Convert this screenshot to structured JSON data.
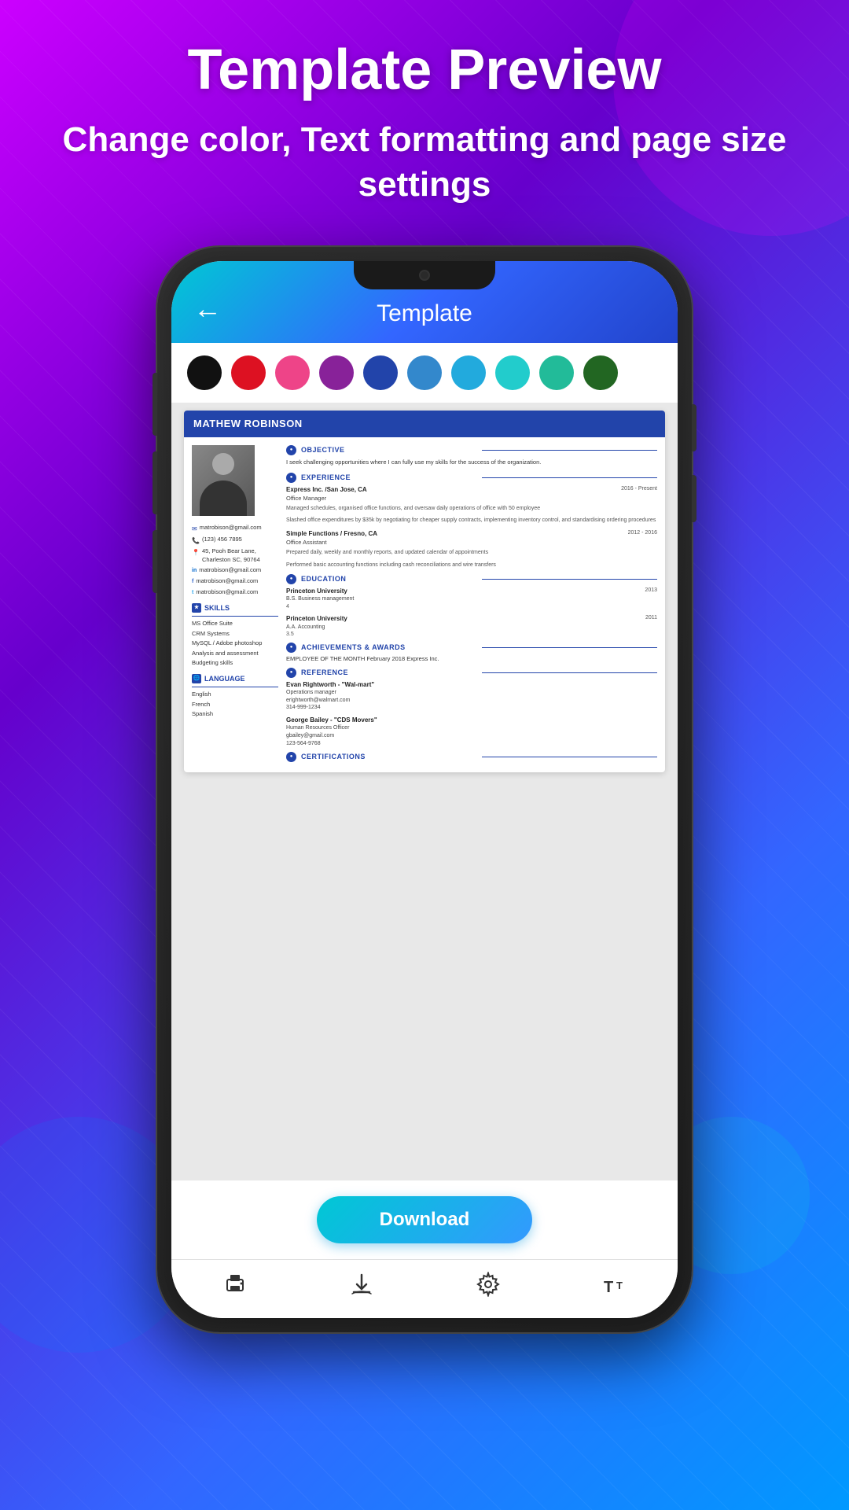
{
  "background": {
    "gradient_start": "#cc00ff",
    "gradient_end": "#3366ff"
  },
  "header": {
    "title": "Template Preview",
    "subtitle": "Change color, Text formatting and page size settings"
  },
  "app": {
    "screen_title": "Template",
    "back_button": "←",
    "colors": [
      {
        "name": "black",
        "hex": "#111111"
      },
      {
        "name": "red",
        "hex": "#dd1122"
      },
      {
        "name": "pink",
        "hex": "#ee4488"
      },
      {
        "name": "purple",
        "hex": "#882299"
      },
      {
        "name": "dark-blue",
        "hex": "#2244aa"
      },
      {
        "name": "blue",
        "hex": "#3388cc"
      },
      {
        "name": "sky-blue",
        "hex": "#22aadd"
      },
      {
        "name": "cyan",
        "hex": "#22cccc"
      },
      {
        "name": "teal",
        "hex": "#22bb99"
      },
      {
        "name": "green",
        "hex": "#226622"
      }
    ],
    "resume": {
      "name": "MATHEW ROBINSON",
      "photo_alt": "profile photo",
      "contact": {
        "email": "matrobison@gmail.com",
        "phone": "(123) 456 7895",
        "address": "45, Pooh Bear Lane, Charleston SC, 90764",
        "linkedin": "matrobison@gmail.com",
        "facebook": "matrobison@gmail.com",
        "twitter": "matrobison@gmail.com"
      },
      "skills": {
        "section_title": "SKILLS",
        "items": [
          "MS Office Suite",
          "CRM Systems",
          "MySQL / Adobe photoshop",
          "Analysis and assessment",
          "Budgeting skills"
        ]
      },
      "languages": {
        "section_title": "LANGUAGE",
        "items": [
          "English",
          "French",
          "Spanish"
        ]
      },
      "objective": {
        "section_title": "OBJECTIVE",
        "text": "I seek challenging opportunities where I can fully use my skills for the success of the organization."
      },
      "experience": {
        "section_title": "EXPERIENCE",
        "items": [
          {
            "company": "Express Inc. /San Jose, CA",
            "dates": "2016 - Present",
            "role": "Office Manager",
            "description": "Managed schedules, organised office functions, and oversaw daily operations of office with 50 employee"
          },
          {
            "company": "Express Inc. /San Jose, CA",
            "dates": "2016 - Present",
            "role": "Office Manager",
            "description": "Slashed office expenditures by $35k by negotiating for cheaper supply contracts, implementing inventory control, and standardising ordering procedures"
          },
          {
            "company": "Simple Functions / Fresno, CA",
            "dates": "2012 - 2016",
            "role": "Office Assistant",
            "description": "Prepared daily, weekly and monthly reports, and updated calendar of appointments"
          },
          {
            "company": "",
            "dates": "",
            "role": "",
            "description": "Performed basic accounting functions including cash reconciliations and wire transfers"
          }
        ]
      },
      "education": {
        "section_title": "EDUCATION",
        "items": [
          {
            "school": "Princeton University",
            "year": "2013",
            "degree": "B.S. Business management",
            "gpa": "4"
          },
          {
            "school": "Princeton University",
            "year": "2011",
            "degree": "A.A. Accounting",
            "gpa": "3.5"
          }
        ]
      },
      "achievements": {
        "section_title": "ACHIEVEMENTS & AWARDS",
        "text": "EMPLOYEE OF THE MONTH February 2018 Express Inc."
      },
      "references": {
        "section_title": "REFERENCE",
        "items": [
          {
            "name": "Evan Rightworth - \"Wal-mart\"",
            "role": "Operations manager",
            "email": "erightworth@walmart.com",
            "phone": "314-999-1234"
          },
          {
            "name": "George Bailey - \"CDS Movers\"",
            "role": "Human Resources Officer",
            "email": "gbailey@gmail.com",
            "phone": "123-564-9768"
          }
        ]
      },
      "certifications": {
        "section_title": "CERTIFICATIONS"
      }
    },
    "download_button": "Download",
    "bottom_nav": {
      "icons": [
        "print",
        "download",
        "settings",
        "text-size"
      ]
    }
  }
}
